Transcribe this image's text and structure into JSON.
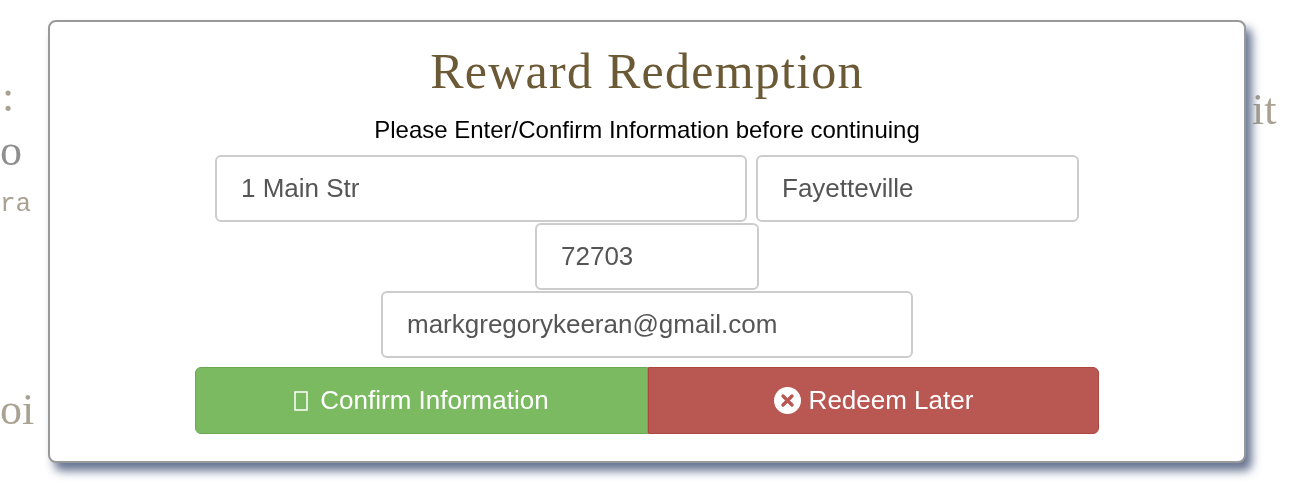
{
  "background": {
    "fragments": [
      ":",
      "o",
      "ra",
      "oi",
      "it"
    ]
  },
  "dialog": {
    "title": "Reward Redemption",
    "subtitle": "Please Enter/Confirm Information before continuing",
    "fields": [
      {
        "kind": "address",
        "value": "1 Main Str"
      },
      {
        "kind": "city",
        "value": "Fayetteville"
      },
      {
        "kind": "zip",
        "value": "72703"
      },
      {
        "kind": "email",
        "value": "markgregorykeeran@gmail.com"
      }
    ],
    "buttons": [
      {
        "kind": "confirm",
        "label": "Confirm Information"
      },
      {
        "kind": "later",
        "label": "Redeem Later"
      }
    ]
  }
}
